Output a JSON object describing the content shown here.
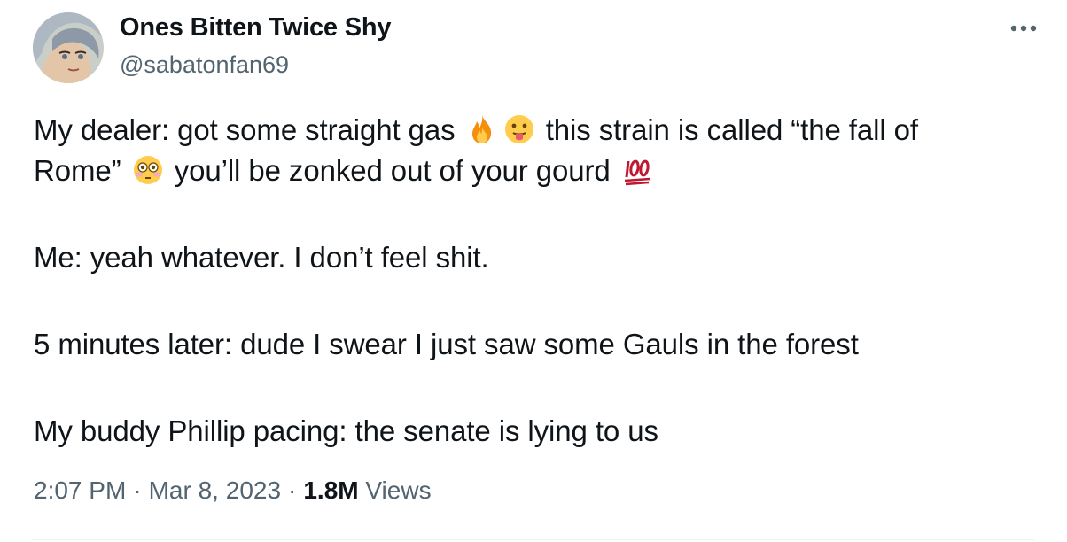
{
  "author": {
    "display_name": "Ones Bitten Twice Shy",
    "handle": "@sabatonfan69",
    "avatar": "avatar-image"
  },
  "menu": {
    "icon": "more-horizontal-icon"
  },
  "tweet": {
    "p1_line1_a": "My dealer: got some straight gas",
    "emoji_fire": "fire-emoji",
    "emoji_tongue": "tongue-out-emoji",
    "p1_line1_b": "this strain is called “the fall of",
    "p1_line2_a": "Rome”",
    "emoji_flushed": "flushed-face-emoji",
    "p1_line2_b": "you’ll be zonked out of your gourd",
    "emoji_hundred": "hundred-points-emoji",
    "p2": "Me: yeah whatever. I don’t feel shit.",
    "p3": "5 minutes later: dude I swear I just saw some Gauls in the forest",
    "p4": "My buddy Phillip pacing: the senate is lying to us"
  },
  "meta": {
    "time": "2:07 PM",
    "separator": "·",
    "date": "Mar 8, 2023",
    "views_count": "1.8M",
    "views_label": "Views"
  },
  "colors": {
    "text_primary": "#0f1419",
    "text_secondary": "#536471",
    "divider": "#eff3f4"
  }
}
